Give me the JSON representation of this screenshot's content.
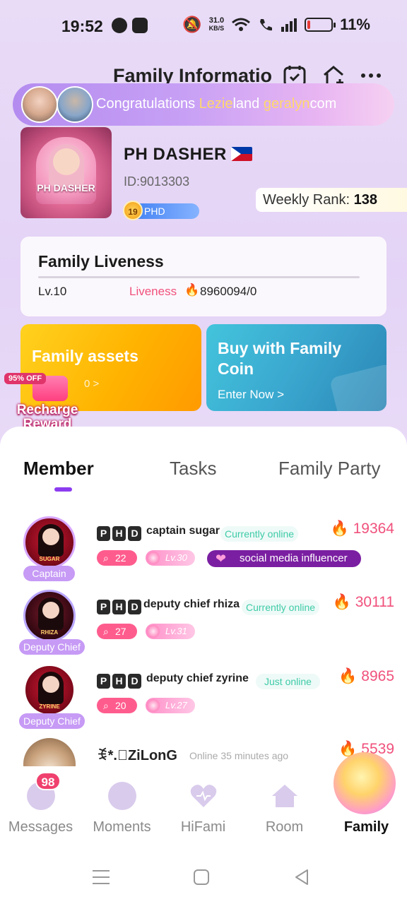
{
  "status_bar": {
    "time": "19:52",
    "net_speed_value": "31.0",
    "net_speed_unit": "KB/S",
    "battery": "11%",
    "battery_level": 0.11
  },
  "header": {
    "title": "Family Informatio",
    "icons": [
      "calendar-check-icon",
      "home-plus-icon",
      "more-icon"
    ]
  },
  "banner": {
    "prefix": "Congratulations ",
    "name1": "Lezie",
    "middle": "land ",
    "name2": "geralyn",
    "suffix": "com"
  },
  "family": {
    "cover_label": "PH DASHER",
    "name": "PH DASHER",
    "id": "ID:9013303",
    "level_badge": "19",
    "level_tag": "PHD",
    "weekly_rank_label": "Weekly Rank: ",
    "weekly_rank_value": "138"
  },
  "liveness": {
    "title": "Family Liveness",
    "level": "Lv.10",
    "label": "Liveness",
    "value": "8960094/0"
  },
  "cards": {
    "assets_title": "Family assets",
    "assets_sub": "0 >",
    "coin_title": "Buy with Family Coin",
    "coin_sub": "Enter Now >"
  },
  "recharge": {
    "off_badge": "95% OFF",
    "line1": "Recharge",
    "line2": "Reward"
  },
  "tabs": [
    {
      "label": "Member",
      "active": true
    },
    {
      "label": "Tasks",
      "active": false
    },
    {
      "label": "Family Party",
      "active": false
    }
  ],
  "members": [
    {
      "role": "Captain",
      "avatar_tag": "SUGAR",
      "name": "captain sugar",
      "status": "Currently online",
      "score": "19364",
      "messages": "22",
      "level": "Lv.30",
      "badge": "social media influencer"
    },
    {
      "role": "Deputy Chief",
      "avatar_tag": "RHIZA",
      "name": "deputy chief rhiza",
      "status": "Currently online",
      "score": "30111",
      "messages": "27",
      "level": "Lv.31"
    },
    {
      "role": "Deputy Chief",
      "avatar_tag": "ZYRINE",
      "name": "deputy chief zyrine",
      "status": "Just online",
      "score": "8965",
      "messages": "20",
      "level": "Lv.27"
    },
    {
      "name": "ꉂ*.゚ZiLonG",
      "status": "Online 35 minutes ago",
      "score": "5539"
    }
  ],
  "phd_letters": [
    "P",
    "H",
    "D"
  ],
  "nav": {
    "messages": "Messages",
    "messages_badge": "98",
    "moments": "Moments",
    "hifami": "HiFami",
    "room": "Room",
    "family": "Family"
  }
}
